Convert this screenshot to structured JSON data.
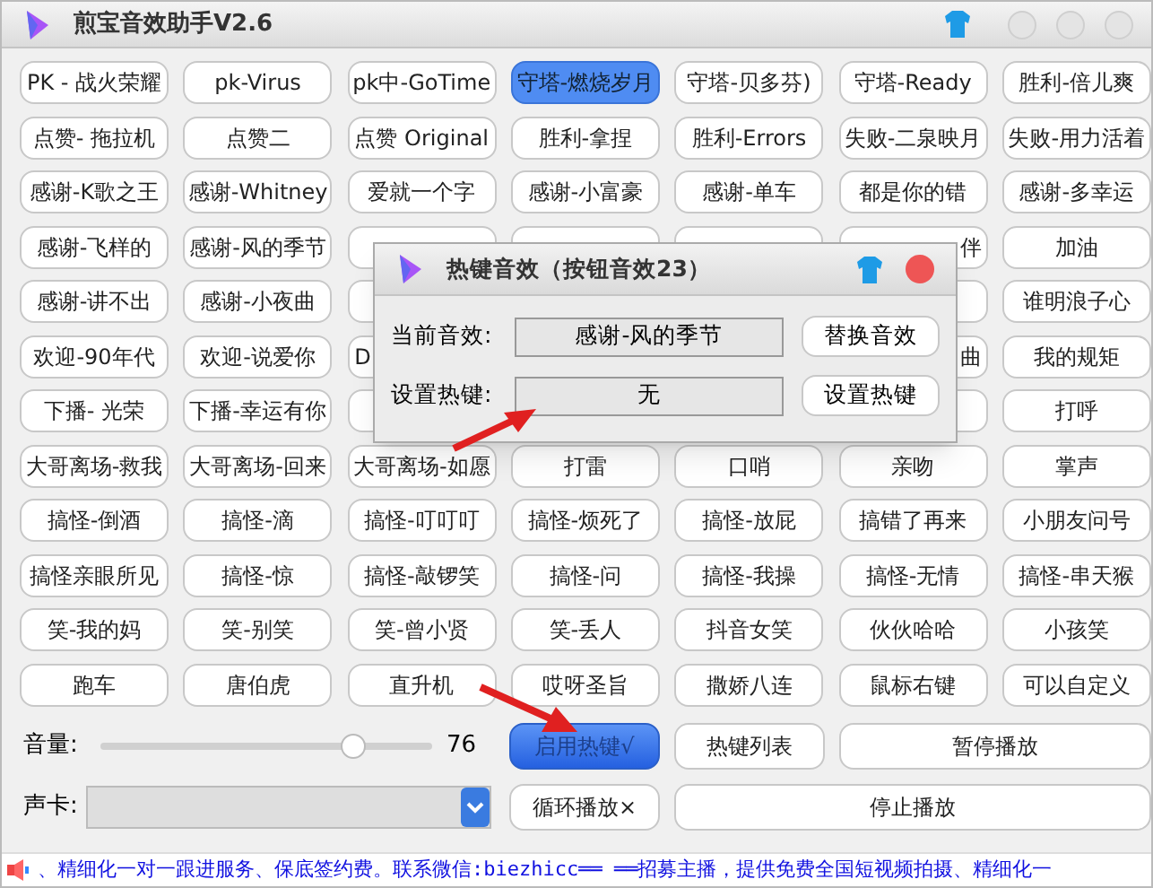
{
  "window": {
    "title": "煎宝音效助手V2.6"
  },
  "sound_buttons": [
    {
      "label": "PK - 战火荣耀",
      "selected": false
    },
    {
      "label": "pk-Virus",
      "selected": false
    },
    {
      "label": "pk中-GoTime",
      "selected": false
    },
    {
      "label": "守塔-燃烧岁月",
      "selected": true
    },
    {
      "label": "守塔-贝多芬)",
      "selected": false
    },
    {
      "label": "守塔-Ready",
      "selected": false
    },
    {
      "label": "胜利-倍儿爽",
      "selected": false
    },
    {
      "label": "点赞- 拖拉机",
      "selected": false
    },
    {
      "label": "点赞二",
      "selected": false
    },
    {
      "label": "点赞 Original",
      "selected": false
    },
    {
      "label": "胜利-拿捏",
      "selected": false
    },
    {
      "label": "胜利-Errors",
      "selected": false
    },
    {
      "label": "失败-二泉映月",
      "selected": false
    },
    {
      "label": "失败-用力活着",
      "selected": false
    },
    {
      "label": "感谢-K歌之王",
      "selected": false
    },
    {
      "label": "感谢-Whitney",
      "selected": false
    },
    {
      "label": "爱就一个字",
      "selected": false
    },
    {
      "label": "感谢-小富豪",
      "selected": false
    },
    {
      "label": "感谢-单车",
      "selected": false
    },
    {
      "label": "都是你的错",
      "selected": false
    },
    {
      "label": "感谢-多幸运",
      "selected": false
    },
    {
      "label": "感谢-飞样的",
      "selected": false
    },
    {
      "label": "感谢-风的季节",
      "selected": false
    },
    {
      "kind": "covered"
    },
    {
      "kind": "covered"
    },
    {
      "kind": "covered"
    },
    {
      "kind": "partial_right",
      "label": "伴",
      "selected": false
    },
    {
      "label": "加油",
      "selected": false
    },
    {
      "label": "感谢-讲不出",
      "selected": false
    },
    {
      "label": "感谢-小夜曲",
      "selected": false
    },
    {
      "kind": "covered"
    },
    {
      "kind": "hidden"
    },
    {
      "kind": "hidden"
    },
    {
      "kind": "covered"
    },
    {
      "label": "谁明浪子心",
      "selected": false
    },
    {
      "label": "欢迎-90年代",
      "selected": false
    },
    {
      "label": "欢迎-说爱你",
      "selected": false
    },
    {
      "kind": "partial_left",
      "label": "D",
      "selected": false
    },
    {
      "kind": "hidden"
    },
    {
      "kind": "hidden"
    },
    {
      "kind": "partial_right",
      "label": "曲",
      "selected": false
    },
    {
      "label": "我的规矩",
      "selected": false
    },
    {
      "label": "下播- 光荣",
      "selected": false
    },
    {
      "label": "下播-幸运有你",
      "selected": false
    },
    {
      "kind": "covered"
    },
    {
      "kind": "covered"
    },
    {
      "kind": "covered"
    },
    {
      "kind": "covered"
    },
    {
      "label": "打呼",
      "selected": false
    },
    {
      "label": "大哥离场-救我",
      "selected": false
    },
    {
      "label": "大哥离场-回来",
      "selected": false
    },
    {
      "label": "大哥离场-如愿",
      "selected": false
    },
    {
      "label": "打雷",
      "selected": false
    },
    {
      "label": "口哨",
      "selected": false
    },
    {
      "label": "亲吻",
      "selected": false
    },
    {
      "label": "掌声",
      "selected": false
    },
    {
      "label": "搞怪-倒酒",
      "selected": false
    },
    {
      "label": "搞怪-滴",
      "selected": false
    },
    {
      "label": "搞怪-叮叮叮",
      "selected": false
    },
    {
      "label": "搞怪-烦死了",
      "selected": false
    },
    {
      "label": "搞怪-放屁",
      "selected": false
    },
    {
      "label": "搞错了再来",
      "selected": false
    },
    {
      "label": "小朋友问号",
      "selected": false
    },
    {
      "label": "搞怪亲眼所见",
      "selected": false
    },
    {
      "label": "搞怪-惊",
      "selected": false
    },
    {
      "label": "搞怪-敲锣笑",
      "selected": false
    },
    {
      "label": "搞怪-问",
      "selected": false
    },
    {
      "label": "搞怪-我操",
      "selected": false
    },
    {
      "label": "搞怪-无情",
      "selected": false
    },
    {
      "label": "搞怪-串天猴",
      "selected": false
    },
    {
      "label": "笑-我的妈",
      "selected": false
    },
    {
      "label": "笑-别笑",
      "selected": false
    },
    {
      "label": "笑-曾小贤",
      "selected": false
    },
    {
      "label": "笑-丢人",
      "selected": false
    },
    {
      "label": "抖音女笑",
      "selected": false
    },
    {
      "label": "伙伙哈哈",
      "selected": false
    },
    {
      "label": "小孩笑",
      "selected": false
    },
    {
      "label": "跑车",
      "selected": false
    },
    {
      "label": "唐伯虎",
      "selected": false
    },
    {
      "label": "直升机",
      "selected": false
    },
    {
      "label": "哎呀圣旨",
      "selected": false
    },
    {
      "label": "撒娇八连",
      "selected": false
    },
    {
      "label": "鼠标右键",
      "selected": false
    },
    {
      "label": "可以自定义",
      "selected": false
    }
  ],
  "volume": {
    "label": "音量:",
    "level": 0.76,
    "reading": "76"
  },
  "sound_card": {
    "label": "声卡:",
    "disabled": true
  },
  "controls": [
    {
      "label": "启用热键√",
      "selected": true
    },
    {
      "label": "热键列表",
      "selected": false
    },
    {
      "label": "暂停播放",
      "selected": false
    },
    {
      "label": "循环播放×",
      "selected": false
    },
    {
      "label": "停止播放",
      "selected": false
    }
  ],
  "marquee": "、精细化一对一跟进服务、保底签约费。联系微信:biezhicc══ ══招募主播，提供免费全国短视频拍摄、精细化一",
  "dialog": {
    "title": "热键音效（按钮音效23）",
    "current_label": "当前音效:",
    "current_value": "感谢-风的季节",
    "replace_button": "替换音效",
    "hotkey_label": "设置热键:",
    "hotkey_value": "无",
    "set_button": "设置热键"
  }
}
